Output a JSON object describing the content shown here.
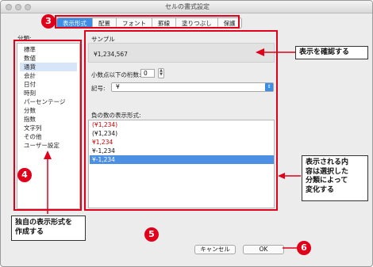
{
  "window": {
    "title": "セルの書式設定"
  },
  "tabs": [
    {
      "label": "表示形式",
      "active": true
    },
    {
      "label": "配置",
      "active": false
    },
    {
      "label": "フォント",
      "active": false
    },
    {
      "label": "罫線",
      "active": false
    },
    {
      "label": "塗りつぶし",
      "active": false
    },
    {
      "label": "保護",
      "active": false
    }
  ],
  "category": {
    "label": "分類:",
    "items": [
      "標準",
      "数値",
      "通貨",
      "会計",
      "日付",
      "時刻",
      "パーセンテージ",
      "分数",
      "指数",
      "文字列",
      "その他",
      "ユーザー設定"
    ],
    "selected": "通貨"
  },
  "sample": {
    "label": "サンプル",
    "value": "¥1,234,567"
  },
  "decimal": {
    "label": "小数点以下の桁数:",
    "value": "0"
  },
  "symbol": {
    "label": "記号:",
    "value": "¥"
  },
  "negative": {
    "label": "負の数の表示形式:",
    "items": [
      {
        "text": "(¥1,234)",
        "color": "#cc0000"
      },
      {
        "text": "(¥1,234)",
        "color": "#111111"
      },
      {
        "text": "¥1,234",
        "color": "#cc0000"
      },
      {
        "text": "¥-1,234",
        "color": "#111111"
      },
      {
        "text": "¥-1,234",
        "color": "#ffffff",
        "selected": true
      }
    ]
  },
  "buttons": {
    "cancel": "キャンセル",
    "ok": "OK"
  },
  "callouts": {
    "confirm": "表示を確認する",
    "change": [
      "表示される内",
      "容は選択した",
      "分類によって",
      "変化する"
    ],
    "custom": [
      "独自の表示形式を",
      "作成する"
    ]
  },
  "badges": {
    "b3": "3",
    "b4": "4",
    "b5": "5",
    "b6": "6"
  },
  "colors": {
    "accent": "#3d8ce5",
    "annotation": "#e0001a"
  }
}
